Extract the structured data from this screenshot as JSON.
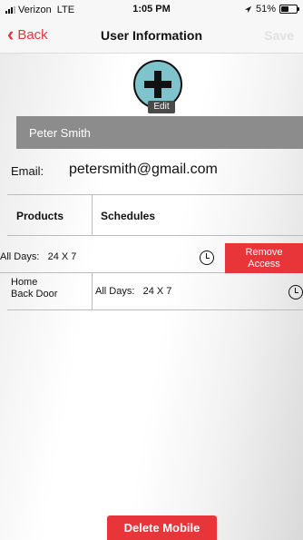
{
  "status_bar": {
    "carrier": "Verizon",
    "network": "LTE",
    "time": "1:05 PM",
    "battery": "51%",
    "battery_level": 0.51
  },
  "nav": {
    "back_label": "Back",
    "title": "User Information",
    "save_label": "Save"
  },
  "avatar": {
    "edit_label": "Edit"
  },
  "user": {
    "name": "Peter Smith",
    "email_label": "Email:",
    "email": "petersmith@gmail.com"
  },
  "table": {
    "headers": [
      "Products",
      "Schedules"
    ],
    "rows": [
      {
        "schedule_label": "All Days:",
        "schedule_value": "24 X 7",
        "action_label_line1": "Remove",
        "action_label_line2": "Access"
      },
      {
        "product_line1": "Home",
        "product_line2": "Back Door",
        "schedule_label": "All Days:",
        "schedule_value": "24 X 7"
      }
    ]
  },
  "footer": {
    "delete_label": "Delete Mobile"
  },
  "colors": {
    "accent": "#e8353a",
    "avatar": "#7fc4cc",
    "name_bar": "#8c8c8c"
  }
}
